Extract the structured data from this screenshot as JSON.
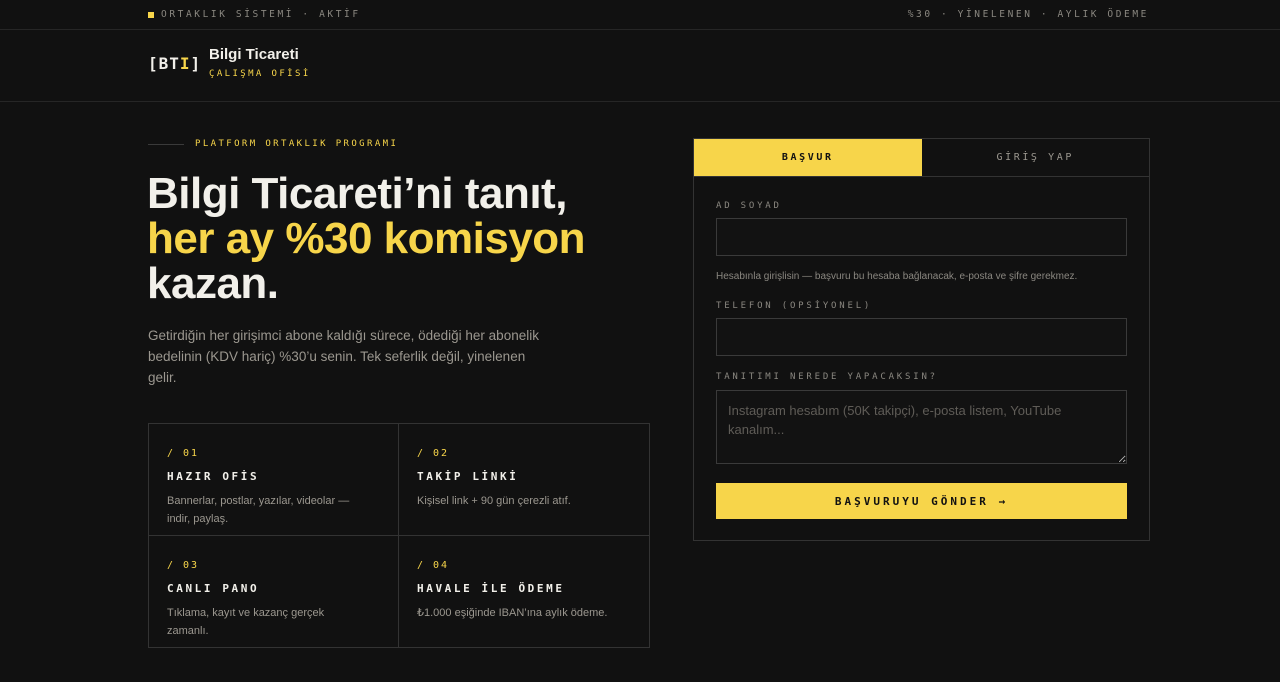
{
  "topbar": {
    "status": "ORTAKLIK SİSTEMİ · AKTİF",
    "right": "%30 · YİNELENEN · AYLIK ÖDEME"
  },
  "brand": {
    "logo_open": "[BT",
    "logo_accent": "I",
    "logo_close": "]",
    "name": "Bilgi Ticareti",
    "sub": "ÇALIŞMA OFİSİ"
  },
  "hero": {
    "eyebrow": "PLATFORM ORTAKLIK PROGRAMI",
    "line1": "Bilgi Ticareti’ni tanıt,",
    "line2": "her ay %30 komisyon",
    "line3": "kazan.",
    "lead": "Getirdiğin her girişimci abone kaldığı sürece, ödediği her abonelik bedelinin (KDV hariç) %30’u senin. Tek seferlik değil, yinelenen gelir."
  },
  "features": [
    {
      "num": "/ 01",
      "title": "HAZIR OFİS",
      "desc": "Bannerlar, postlar, yazılar, videolar — indir, paylaş."
    },
    {
      "num": "/ 02",
      "title": "TAKİP LİNKİ",
      "desc": "Kişisel link + 90 gün çerezli atıf."
    },
    {
      "num": "/ 03",
      "title": "CANLI PANO",
      "desc": "Tıklama, kayıt ve kazanç gerçek zamanlı."
    },
    {
      "num": "/ 04",
      "title": "HAVALE İLE ÖDEME",
      "desc": "₺1.000 eşiğinde IBAN’ına aylık ödeme."
    }
  ],
  "form": {
    "tab_apply": "BAŞVUR",
    "tab_login": "GİRİŞ YAP",
    "name_label": "AD SOYAD",
    "name_value": "",
    "hint": "Hesabınla girişlisin — başvuru bu hesaba bağlanacak, e-posta ve şifre gerekmez.",
    "phone_label": "TELEFON (OPSİYONEL)",
    "phone_value": "",
    "where_label": "TANITIMI NEREDE YAPACAKSIN?",
    "where_placeholder": "Instagram hesabım (50K takipçi), e-posta listem, YouTube kanalım...",
    "submit": "BAŞVURUYU GÖNDER →"
  },
  "colors": {
    "accent": "#f7d54a",
    "background": "#111111"
  }
}
